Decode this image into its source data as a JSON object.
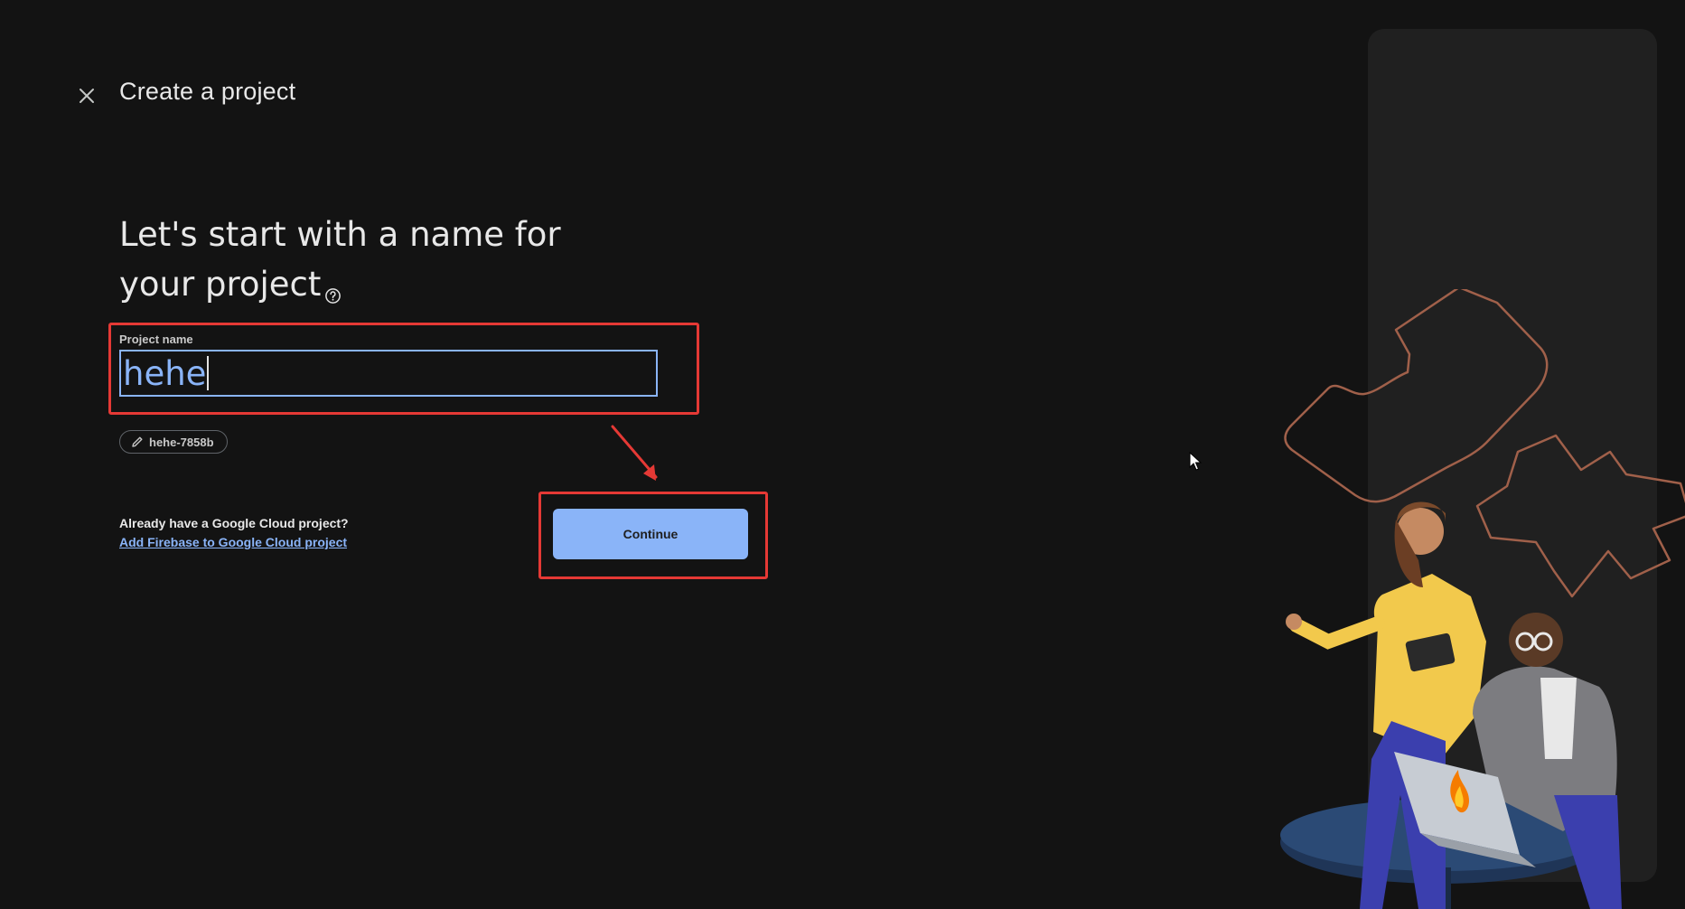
{
  "header": {
    "title": "Create a project",
    "close_icon": "close-icon"
  },
  "main": {
    "headline_line1": "Let's start with a name for",
    "headline_line2": "your project",
    "help_icon": "help-circle-icon",
    "project_field": {
      "label": "Project name",
      "value": "hehe"
    },
    "project_id_chip": {
      "icon": "pencil-icon",
      "text": "hehe-7858b"
    },
    "gcloud": {
      "question": "Already have a Google Cloud project?",
      "link": "Add Firebase to Google Cloud project"
    },
    "continue_label": "Continue"
  },
  "colors": {
    "background": "#131313",
    "accent": "#8ab4f8",
    "annotation": "#e53935",
    "illustration_outline": "#a0604a"
  }
}
